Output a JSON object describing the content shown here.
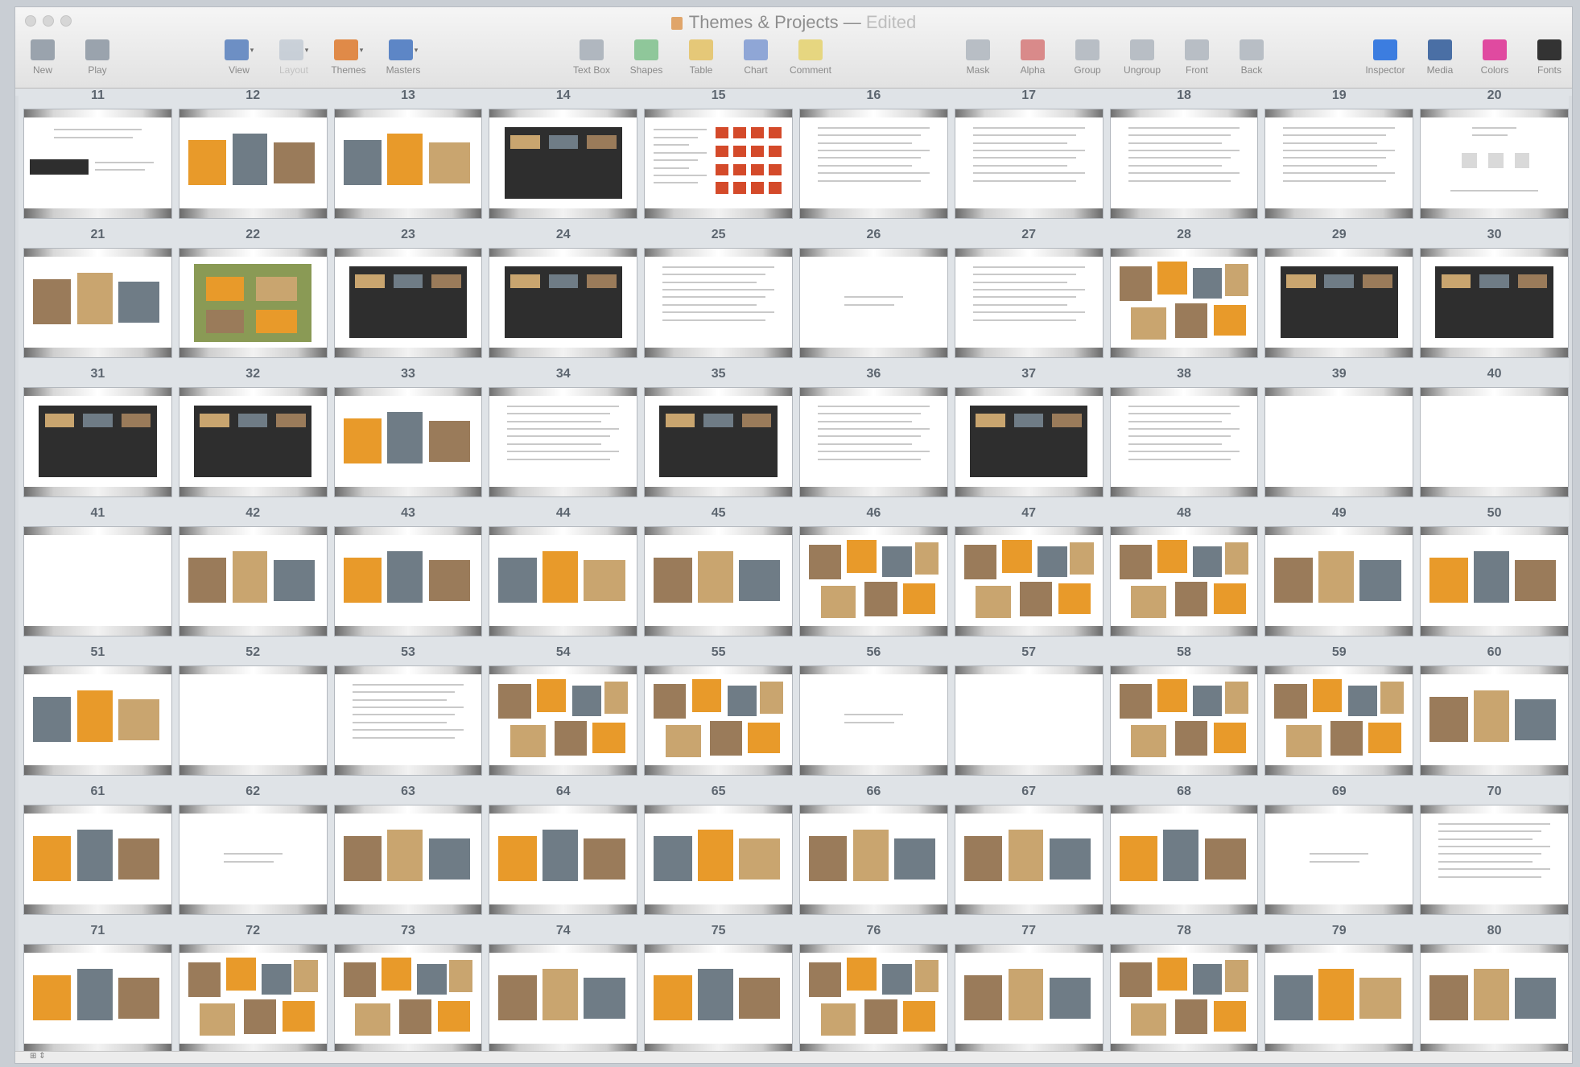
{
  "window": {
    "title": "Themes & Projects",
    "title_separator": "—",
    "status": "Edited"
  },
  "toolbar": {
    "left": [
      {
        "label": "New",
        "icon": "new-slide-icon",
        "color": "#9aa3ad"
      },
      {
        "label": "Play",
        "icon": "play-icon",
        "color": "#9aa3ad"
      }
    ],
    "middle": [
      {
        "label": "View",
        "icon": "view-icon",
        "color": "#6d8fc4",
        "caret": true
      },
      {
        "label": "Layout",
        "icon": "layout-icon",
        "color": "#9fb0c2",
        "caret": true,
        "dim": true
      },
      {
        "label": "Themes",
        "icon": "themes-icon",
        "color": "#e08a48",
        "caret": true
      },
      {
        "label": "Masters",
        "icon": "masters-icon",
        "color": "#5d86c6",
        "caret": true
      }
    ],
    "insert": [
      {
        "label": "Text Box",
        "icon": "text-box-icon",
        "color": "#b0b7bf"
      },
      {
        "label": "Shapes",
        "icon": "shapes-icon",
        "color": "#8fc79a"
      },
      {
        "label": "Table",
        "icon": "table-icon",
        "color": "#e5c878"
      },
      {
        "label": "Chart",
        "icon": "chart-icon",
        "color": "#8fa6d6"
      },
      {
        "label": "Comment",
        "icon": "comment-icon",
        "color": "#e6d680"
      }
    ],
    "arrange": [
      {
        "label": "Mask",
        "icon": "mask-icon",
        "color": "#b8bec5"
      },
      {
        "label": "Alpha",
        "icon": "alpha-icon",
        "color": "#d98a8a"
      },
      {
        "label": "Group",
        "icon": "group-icon",
        "color": "#b8bec5"
      },
      {
        "label": "Ungroup",
        "icon": "ungroup-icon",
        "color": "#b8bec5"
      },
      {
        "label": "Front",
        "icon": "front-icon",
        "color": "#b8bec5"
      },
      {
        "label": "Back",
        "icon": "back-icon",
        "color": "#b8bec5"
      }
    ],
    "right": [
      {
        "label": "Inspector",
        "icon": "inspector-icon",
        "color": "#3c7de0"
      },
      {
        "label": "Media",
        "icon": "media-icon",
        "color": "#4a6fa5"
      },
      {
        "label": "Colors",
        "icon": "colors-icon",
        "color": "#e04aa0"
      },
      {
        "label": "Fonts",
        "icon": "fonts-icon",
        "color": "#333333"
      }
    ]
  },
  "slides": [
    {
      "n": "11",
      "kind": "strip"
    },
    {
      "n": "12",
      "kind": "photos"
    },
    {
      "n": "13",
      "kind": "photos"
    },
    {
      "n": "14",
      "kind": "dark"
    },
    {
      "n": "15",
      "kind": "redgrid"
    },
    {
      "n": "16",
      "kind": "text"
    },
    {
      "n": "17",
      "kind": "text"
    },
    {
      "n": "18",
      "kind": "text"
    },
    {
      "n": "19",
      "kind": "text"
    },
    {
      "n": "20",
      "kind": "diagram"
    },
    {
      "n": "21",
      "kind": "photos"
    },
    {
      "n": "22",
      "kind": "green"
    },
    {
      "n": "23",
      "kind": "dark"
    },
    {
      "n": "24",
      "kind": "dark"
    },
    {
      "n": "25",
      "kind": "text"
    },
    {
      "n": "26",
      "kind": "sparse"
    },
    {
      "n": "27",
      "kind": "text"
    },
    {
      "n": "28",
      "kind": "collage"
    },
    {
      "n": "29",
      "kind": "dark"
    },
    {
      "n": "30",
      "kind": "dark"
    },
    {
      "n": "31",
      "kind": "dark"
    },
    {
      "n": "32",
      "kind": "dark"
    },
    {
      "n": "33",
      "kind": "photos"
    },
    {
      "n": "34",
      "kind": "text"
    },
    {
      "n": "35",
      "kind": "dark"
    },
    {
      "n": "36",
      "kind": "text"
    },
    {
      "n": "37",
      "kind": "dark"
    },
    {
      "n": "38",
      "kind": "text"
    },
    {
      "n": "39",
      "kind": "blank"
    },
    {
      "n": "40",
      "kind": "blank"
    },
    {
      "n": "41",
      "kind": "blank"
    },
    {
      "n": "42",
      "kind": "photos"
    },
    {
      "n": "43",
      "kind": "photos"
    },
    {
      "n": "44",
      "kind": "photos"
    },
    {
      "n": "45",
      "kind": "photos"
    },
    {
      "n": "46",
      "kind": "collage"
    },
    {
      "n": "47",
      "kind": "collage"
    },
    {
      "n": "48",
      "kind": "collage"
    },
    {
      "n": "49",
      "kind": "photos"
    },
    {
      "n": "50",
      "kind": "photos"
    },
    {
      "n": "51",
      "kind": "photos"
    },
    {
      "n": "52",
      "kind": "blank"
    },
    {
      "n": "53",
      "kind": "text"
    },
    {
      "n": "54",
      "kind": "collage"
    },
    {
      "n": "55",
      "kind": "collage"
    },
    {
      "n": "56",
      "kind": "sparse"
    },
    {
      "n": "57",
      "kind": "blank"
    },
    {
      "n": "58",
      "kind": "collage"
    },
    {
      "n": "59",
      "kind": "collage"
    },
    {
      "n": "60",
      "kind": "photos"
    },
    {
      "n": "61",
      "kind": "photos"
    },
    {
      "n": "62",
      "kind": "sparse"
    },
    {
      "n": "63",
      "kind": "photos"
    },
    {
      "n": "64",
      "kind": "photos"
    },
    {
      "n": "65",
      "kind": "photos"
    },
    {
      "n": "66",
      "kind": "photos"
    },
    {
      "n": "67",
      "kind": "photos"
    },
    {
      "n": "68",
      "kind": "photos"
    },
    {
      "n": "69",
      "kind": "sparse"
    },
    {
      "n": "70",
      "kind": "text"
    },
    {
      "n": "71",
      "kind": "photos"
    },
    {
      "n": "72",
      "kind": "collage"
    },
    {
      "n": "73",
      "kind": "collage"
    },
    {
      "n": "74",
      "kind": "photos"
    },
    {
      "n": "75",
      "kind": "photos"
    },
    {
      "n": "76",
      "kind": "collage"
    },
    {
      "n": "77",
      "kind": "photos"
    },
    {
      "n": "78",
      "kind": "collage"
    },
    {
      "n": "79",
      "kind": "photos"
    },
    {
      "n": "80",
      "kind": "photos"
    }
  ],
  "palette": {
    "orange": "#e89a2a",
    "dark": "#2e2e2e",
    "green": "#8a9a55",
    "blue": "#2f56b8",
    "red": "#d44a2a",
    "photo_a": "#9a7b5a",
    "photo_b": "#6f7c86",
    "photo_c": "#c9a56f"
  },
  "footer": {
    "view_label": "⊞ ⇕"
  }
}
